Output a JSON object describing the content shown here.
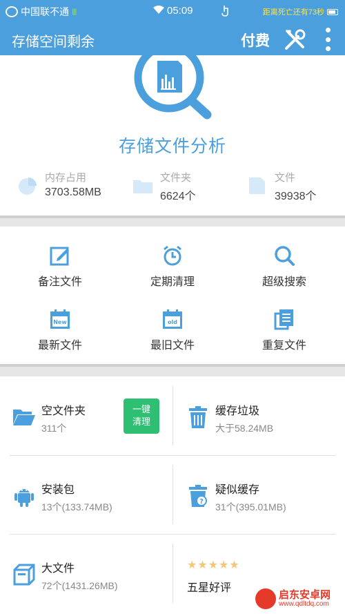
{
  "status_bar": {
    "carrier": "中国联不通",
    "signal": "||||",
    "time": "05:09",
    "countdown": "距离死亡还有73秒"
  },
  "app_bar": {
    "title": "存储空间剩余",
    "pay_label": "付费"
  },
  "analysis": {
    "heading": "存储文件分析",
    "stats": [
      {
        "label": "内存占用",
        "value": "3703.58MB",
        "icon": "pie-chart-icon"
      },
      {
        "label": "文件夹",
        "value": "6624个",
        "icon": "folder-icon"
      },
      {
        "label": "文件",
        "value": "39938个",
        "icon": "file-icon"
      }
    ]
  },
  "quick_actions": [
    {
      "label": "备注文件",
      "icon": "edit-note-icon"
    },
    {
      "label": "定期清理",
      "icon": "alarm-clock-icon"
    },
    {
      "label": "超级搜索",
      "icon": "search-icon"
    },
    {
      "label": "最新文件",
      "icon": "calendar-new-icon"
    },
    {
      "label": "最旧文件",
      "icon": "calendar-old-icon"
    },
    {
      "label": "重复文件",
      "icon": "duplicate-files-icon"
    }
  ],
  "tools": {
    "empty_folder": {
      "title": "空文件夹",
      "sub": "311个",
      "button": "一键\n清理"
    },
    "cache_junk": {
      "title": "缓存垃圾",
      "sub": "大于58.24MB"
    },
    "apk": {
      "title": "安装包",
      "sub": "13个(133.74MB)"
    },
    "suspect_cache": {
      "title": "疑似缓存",
      "sub": "31个(395.01MB)"
    },
    "big_file": {
      "title": "大文件",
      "sub": "72个(1431.26MB)"
    },
    "rating": {
      "stars": "★★★★★",
      "title": "五星好评"
    }
  },
  "watermark": {
    "brand": "启东安卓网",
    "url": "www.qdltdq.com"
  },
  "colors": {
    "primary": "#4a9fdc",
    "green": "#2fbf73",
    "star": "#f3c77a"
  }
}
